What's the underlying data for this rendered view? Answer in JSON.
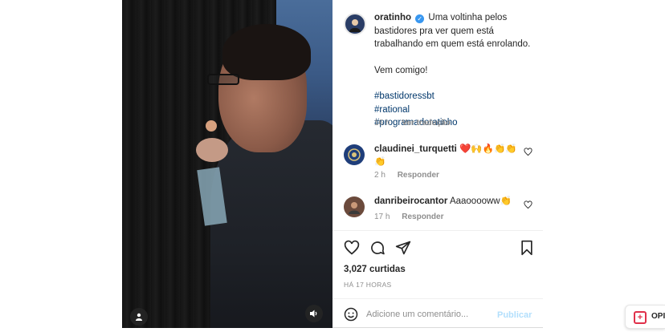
{
  "post": {
    "author": "oratinho",
    "caption_line1": "Uma voltinha pelos bastidores pra ver quem está trabalhando em quem está enrolando.",
    "caption_line2": "Vem comigo!",
    "hashtags": [
      "#bastidoressbt",
      "#rational",
      "#programadoratinho"
    ],
    "time": "16 h",
    "translate": "Ver tradução"
  },
  "comments": [
    {
      "user": "claudinei_turquetti",
      "text": "❤️🙌🔥👏👏👏",
      "time": "2 h",
      "reply": "Responder"
    },
    {
      "user": "danribeirocantor",
      "text": "Aaaooooww👏",
      "time": "17 h",
      "reply": "Responder"
    }
  ],
  "engagement": {
    "likes": "3,027 curtidas",
    "ago": "HÁ 17 HORAS"
  },
  "comment_box": {
    "placeholder": "Adicione um comentário...",
    "publish": "Publicar"
  },
  "extension": {
    "label": "OPI"
  },
  "colors": {
    "link": "#00376b",
    "verified": "#3897f0",
    "muted": "#8e8e8e",
    "publish_disabled": "#b2dffc"
  },
  "icons": {
    "like": "heart-icon",
    "comment": "comment-icon",
    "share": "paper-plane-icon",
    "save": "bookmark-icon",
    "emoji": "smiley-icon",
    "mute": "speaker-icon",
    "tag": "user-icon"
  }
}
